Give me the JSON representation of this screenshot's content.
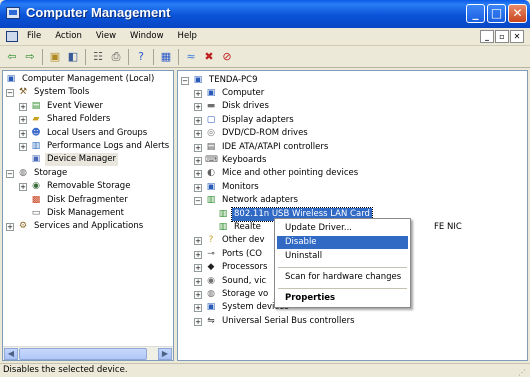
{
  "window": {
    "title": "Computer Management"
  },
  "menubar": {
    "items": [
      "File",
      "Action",
      "View",
      "Window",
      "Help"
    ]
  },
  "left_tree": [
    {
      "label": "Computer Management (Local)",
      "icon": "computer-icon",
      "level": 0,
      "expander": ""
    },
    {
      "label": "System Tools",
      "icon": "tools-icon",
      "level": 1,
      "expander": "−"
    },
    {
      "label": "Event Viewer",
      "icon": "event-viewer-icon",
      "level": 2,
      "expander": "+"
    },
    {
      "label": "Shared Folders",
      "icon": "shared-folder-icon",
      "level": 2,
      "expander": "+"
    },
    {
      "label": "Local Users and Groups",
      "icon": "users-icon",
      "level": 2,
      "expander": "+"
    },
    {
      "label": "Performance Logs and Alerts",
      "icon": "performance-icon",
      "level": 2,
      "expander": "+"
    },
    {
      "label": "Device Manager",
      "icon": "device-manager-icon",
      "level": 2,
      "expander": "",
      "selected": true
    },
    {
      "label": "Storage",
      "icon": "storage-icon",
      "level": 1,
      "expander": "−"
    },
    {
      "label": "Removable Storage",
      "icon": "removable-storage-icon",
      "level": 2,
      "expander": "+"
    },
    {
      "label": "Disk Defragmenter",
      "icon": "defrag-icon",
      "level": 2,
      "expander": ""
    },
    {
      "label": "Disk Management",
      "icon": "disk-management-icon",
      "level": 2,
      "expander": ""
    },
    {
      "label": "Services and Applications",
      "icon": "services-icon",
      "level": 1,
      "expander": "+"
    }
  ],
  "device_tree": {
    "root": "TENDA-PC9",
    "items": [
      {
        "label": "Computer",
        "icon": "computer-icon",
        "expander": "+"
      },
      {
        "label": "Disk drives",
        "icon": "disk-drive-icon",
        "expander": "+"
      },
      {
        "label": "Display adapters",
        "icon": "display-icon",
        "expander": "+"
      },
      {
        "label": "DVD/CD-ROM drives",
        "icon": "cdrom-icon",
        "expander": "+"
      },
      {
        "label": "IDE ATA/ATAPI controllers",
        "icon": "ide-icon",
        "expander": "+"
      },
      {
        "label": "Keyboards",
        "icon": "keyboard-icon",
        "expander": "+"
      },
      {
        "label": "Mice and other pointing devices",
        "icon": "mouse-icon",
        "expander": "+"
      },
      {
        "label": "Monitors",
        "icon": "monitor-icon",
        "expander": "+"
      },
      {
        "label": "Network adapters",
        "icon": "network-icon",
        "expander": "−"
      },
      {
        "label": "802.11n USB Wireless LAN Card",
        "icon": "network-card-icon",
        "expander": "",
        "child": true,
        "selected": true
      },
      {
        "label": "Realtek RTL8168C(P)/8111C(P) PCI-E Gigabit Ethernet NIC",
        "visible_parts": [
          "Realte",
          "FE NIC"
        ],
        "icon": "network-card-icon",
        "expander": "",
        "child": true
      },
      {
        "label": "Other dev",
        "icon": "other-devices-icon",
        "expander": "+"
      },
      {
        "label": "Ports (CO",
        "icon": "ports-icon",
        "expander": "+"
      },
      {
        "label": "Processors",
        "icon": "processor-icon",
        "expander": "+"
      },
      {
        "label": "Sound, vic",
        "icon": "sound-icon",
        "expander": "+"
      },
      {
        "label": "Storage vo",
        "icon": "storage-icon",
        "expander": "+"
      },
      {
        "label": "System devices",
        "icon": "system-icon",
        "expander": "+"
      },
      {
        "label": "Universal Serial Bus controllers",
        "icon": "usb-icon",
        "expander": "+"
      }
    ]
  },
  "context_menu": {
    "items": [
      {
        "label": "Update Driver...",
        "type": "item"
      },
      {
        "label": "Disable",
        "type": "item",
        "highlighted": true
      },
      {
        "label": "Uninstall",
        "type": "item"
      },
      {
        "type": "separator"
      },
      {
        "label": "Scan for hardware changes",
        "type": "item"
      },
      {
        "type": "separator"
      },
      {
        "label": "Properties",
        "type": "item",
        "bold": true
      }
    ]
  },
  "statusbar": {
    "text": "Disables the selected device."
  },
  "colors": {
    "selection": "#316ac5",
    "titlebar": "#0a53d8"
  }
}
